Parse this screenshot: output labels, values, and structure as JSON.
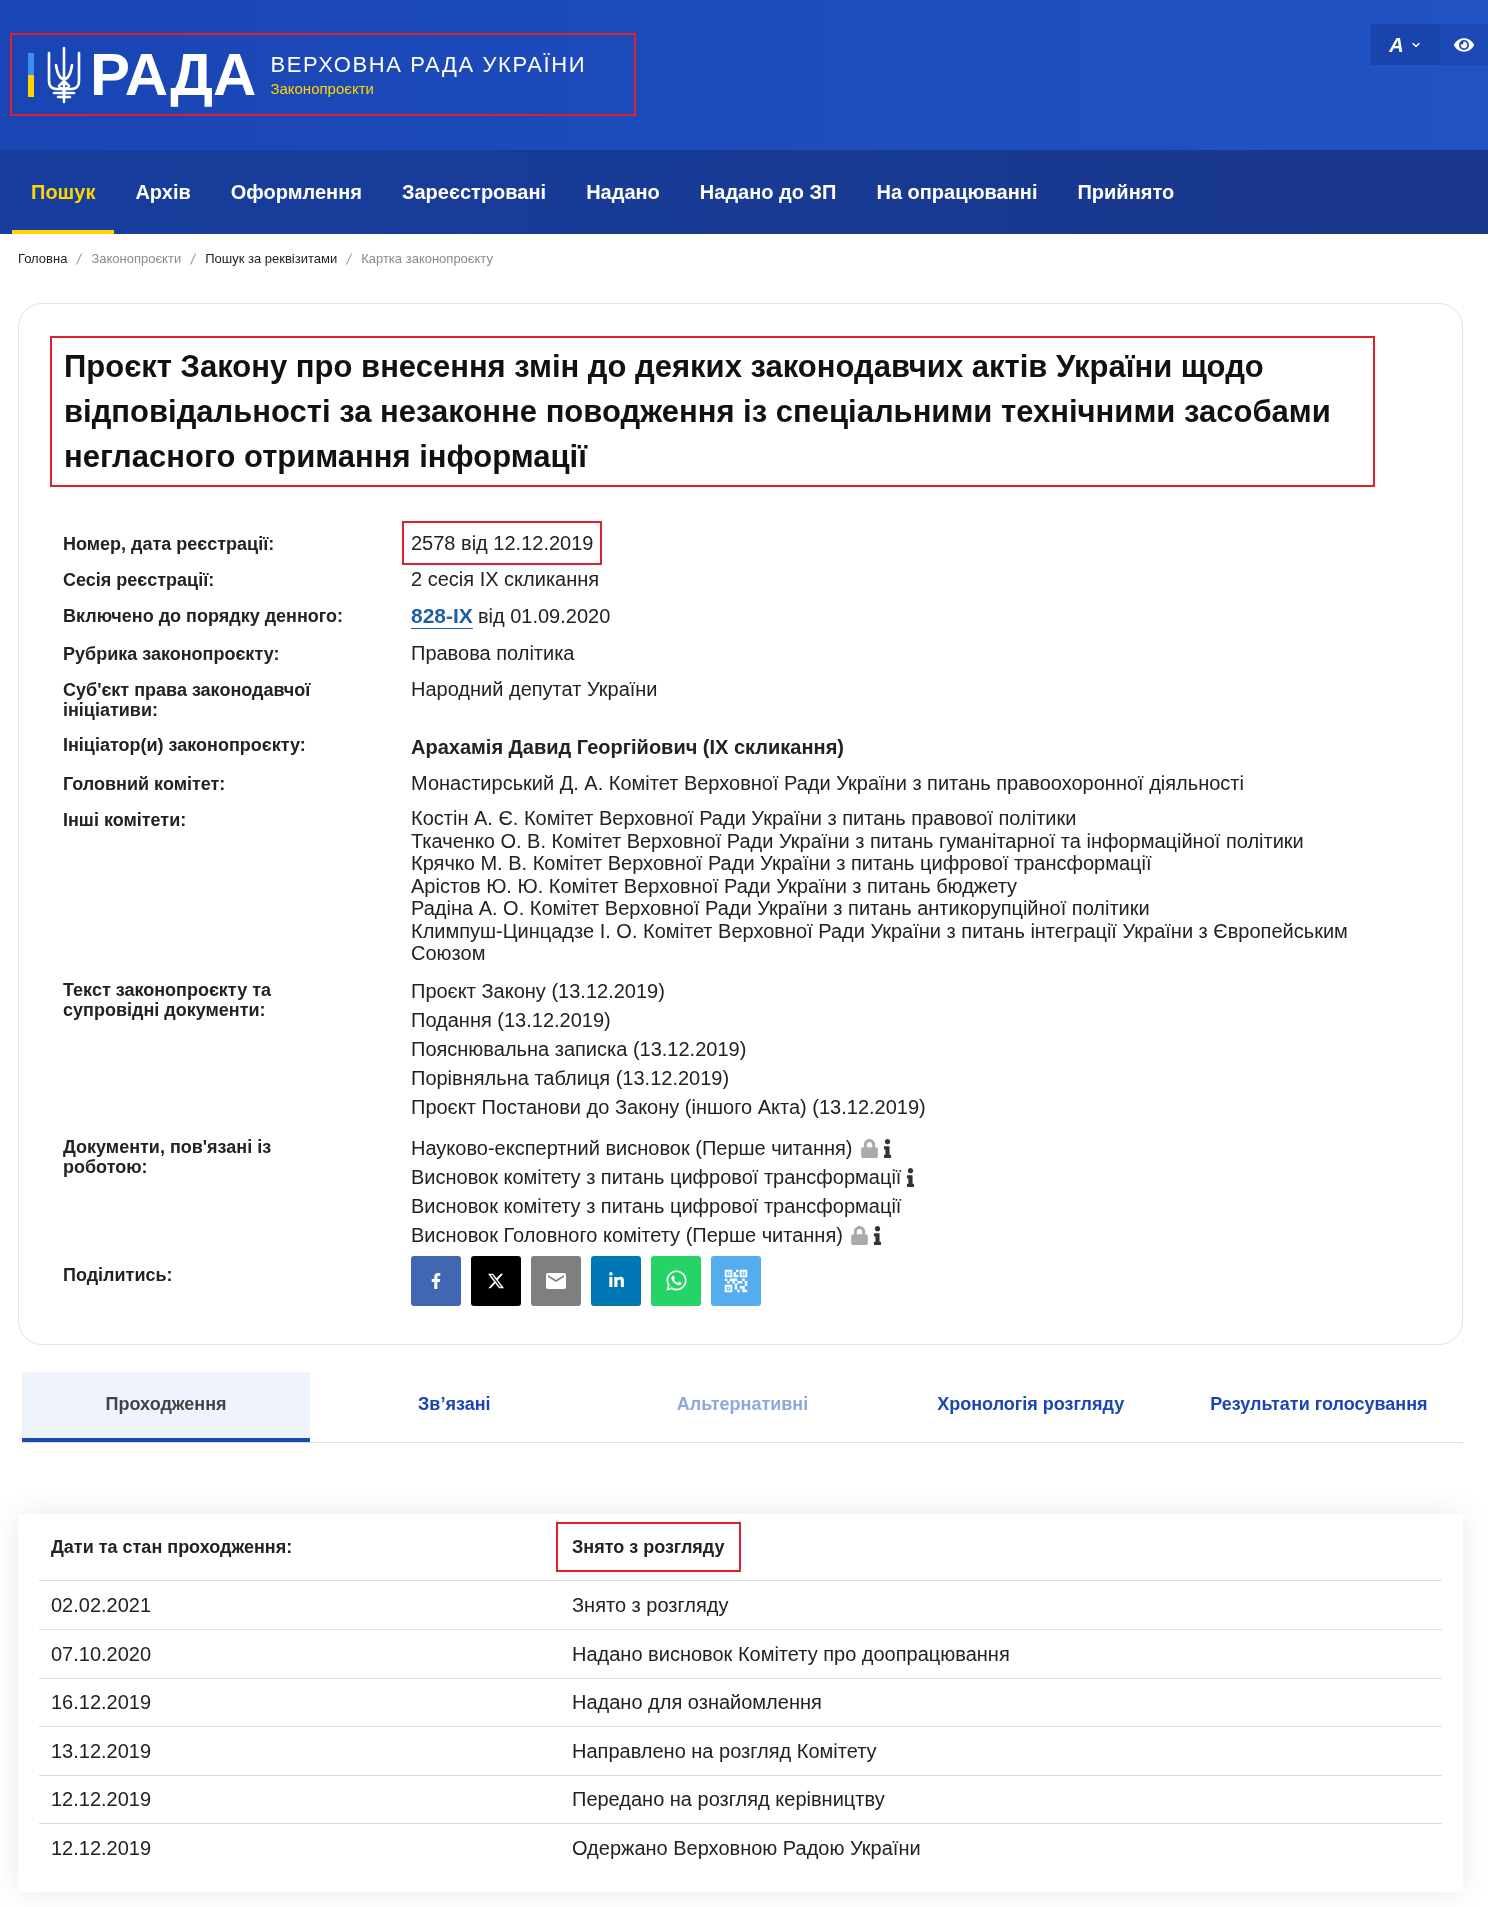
{
  "header": {
    "logo": {
      "wordmark": "РАДА",
      "title": "ВЕРХОВНА РАДА УКРАЇНИ",
      "subtitle": "Законопроєкти",
      "highlighted": true
    },
    "font_menu": {
      "label": "A"
    }
  },
  "nav": [
    {
      "label": "Пошук",
      "selected": true
    },
    {
      "label": "Архів",
      "selected": false
    },
    {
      "label": "Оформлення",
      "selected": false
    },
    {
      "label": "Зареєстровані",
      "selected": false
    },
    {
      "label": "Надано",
      "selected": false
    },
    {
      "label": "Надано до ЗП",
      "selected": false
    },
    {
      "label": "На опрацюванні",
      "selected": false
    },
    {
      "label": "Прийнято",
      "selected": false
    }
  ],
  "breadcrumb": [
    {
      "label": "Головна",
      "muted": false
    },
    {
      "label": "Законопроєкти",
      "muted": true
    },
    {
      "label": "Пошук за реквізитами",
      "muted": false
    },
    {
      "label": "Картка законопроєкту",
      "muted": true
    }
  ],
  "bill": {
    "title": {
      "text": "Проєкт Закону про внесення змін до деяких законодавчих актів України щодо відповідальності за незаконне поводження із спеціальними технічними засобами негласного отримання інформації",
      "highlighted": true
    },
    "fields": [
      {
        "kind": "text",
        "label": "Номер, дата реєстрації:",
        "value": "2578 від 12.12.2019",
        "highlighted": true
      },
      {
        "kind": "text",
        "label": "Сесія реєстрації:",
        "value": "2 сесія IX скликання",
        "highlighted": false
      },
      {
        "kind": "link",
        "label": "Включено до порядку денного:",
        "link": "828-IX",
        "value": "від 01.09.2020"
      },
      {
        "kind": "text",
        "label": "Рубрика законопроєкту:",
        "value": "Правова політика",
        "highlighted": false
      },
      {
        "kind": "text",
        "label": "Суб'єкт права законодавчої ініціативи:",
        "value": "Народний депутат України",
        "highlighted": false
      },
      {
        "kind": "person",
        "label": "Ініціатор(и) законопроєкту:",
        "value": "Арахамія Давид Георгійович (IX скликання)"
      },
      {
        "kind": "text",
        "label": "Головний комітет:",
        "value": "Монастирський Д. А. Комітет Верховної Ради України з питань правоохоронної діяльності",
        "highlighted": false
      },
      {
        "kind": "list",
        "label": "Інші комітети:",
        "items": [
          "Костін А. Є. Комітет Верховної Ради України з питань правової політики",
          "Ткаченко О. В. Комітет Верховної Ради України з питань гуманітарної та інформаційної політики",
          "Крячко М. В. Комітет Верховної Ради України з питань цифрової трансформації",
          "Арістов Ю. Ю. Комітет Верховної Ради України з питань бюджету",
          "Радіна А. О. Комітет Верховної Ради України з питань антикорупційної політики",
          "Климпуш-Цинцадзе І. О. Комітет Верховної Ради України з питань інтеграції України з Європейським Союзом"
        ]
      },
      {
        "kind": "documents",
        "label": "Текст законопроєкту та супровідні документи:",
        "items": [
          {
            "text": "Проєкт Закону (13.12.2019)",
            "locked": false,
            "info": false
          },
          {
            "text": "Подання (13.12.2019)",
            "locked": false,
            "info": false
          },
          {
            "text": "Пояснювальна записка (13.12.2019)",
            "locked": false,
            "info": false
          },
          {
            "text": "Порівняльна таблиця (13.12.2019)",
            "locked": false,
            "info": false
          },
          {
            "text": "Проєкт Постанови до Закону (іншого Акта) (13.12.2019)",
            "locked": false,
            "info": false
          }
        ]
      },
      {
        "kind": "documents",
        "label": "Документи, пов'язані із роботою:",
        "items": [
          {
            "text": "Науково-експертний висновок (Перше читання)",
            "locked": true,
            "info": true
          },
          {
            "text": "Висновок комітету з питань цифрової трансформації",
            "locked": false,
            "info": true
          },
          {
            "text": "Висновок комітету з питань цифрової трансформації",
            "locked": false,
            "info": false
          },
          {
            "text": "Висновок Головного комітету (Перше читання)",
            "locked": true,
            "info": true
          }
        ]
      },
      {
        "kind": "share",
        "label": "Поділитись:",
        "buttons": [
          {
            "kind": "facebook"
          },
          {
            "kind": "x"
          },
          {
            "kind": "email"
          },
          {
            "kind": "linkedin"
          },
          {
            "kind": "whatsapp"
          },
          {
            "kind": "qr"
          }
        ]
      }
    ]
  },
  "tabs": [
    {
      "label": "Проходження",
      "selected": true,
      "disabled": false
    },
    {
      "label": "Зв’язані",
      "selected": false,
      "disabled": false
    },
    {
      "label": "Альтернативні",
      "selected": false,
      "disabled": true
    },
    {
      "label": "Хронологія розгляду",
      "selected": false,
      "disabled": false
    },
    {
      "label": "Результати голосування",
      "selected": false,
      "disabled": false
    }
  ],
  "passage": {
    "columns": [
      {
        "label": "Дати та стан проходження:",
        "highlighted": false
      },
      {
        "label": "Знято з розгляду",
        "highlighted": true
      }
    ],
    "rows": [
      {
        "date": "02.02.2021",
        "event": "Знято з розгляду"
      },
      {
        "date": "07.10.2020",
        "event": "Надано висновок Комітету про доопрацювання"
      },
      {
        "date": "16.12.2019",
        "event": "Надано для ознайомлення"
      },
      {
        "date": "13.12.2019",
        "event": "Направлено на розгляд Комітету"
      },
      {
        "date": "12.12.2019",
        "event": "Передано на розгляд керівництву"
      },
      {
        "date": "12.12.2019",
        "event": "Одержано Верховною Радою України"
      }
    ]
  }
}
